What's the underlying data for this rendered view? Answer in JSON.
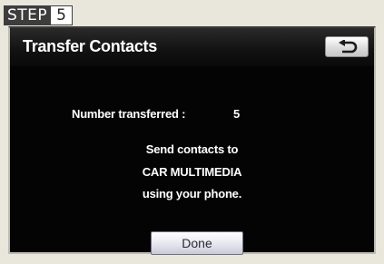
{
  "step": {
    "word": "STEP",
    "number": "5"
  },
  "screen": {
    "title": "Transfer Contacts",
    "back_icon": "back-arrow-icon",
    "number_label": "Number transferred :",
    "number_value": "5",
    "message": [
      "Send contacts to",
      "CAR MULTIMEDIA",
      "using your phone."
    ],
    "done_label": "Done"
  },
  "colors": {
    "screen_bg": "#040404",
    "text": "#ffffff",
    "page_bg": "#e9e7dc",
    "step_badge": "#3d3d3d"
  }
}
